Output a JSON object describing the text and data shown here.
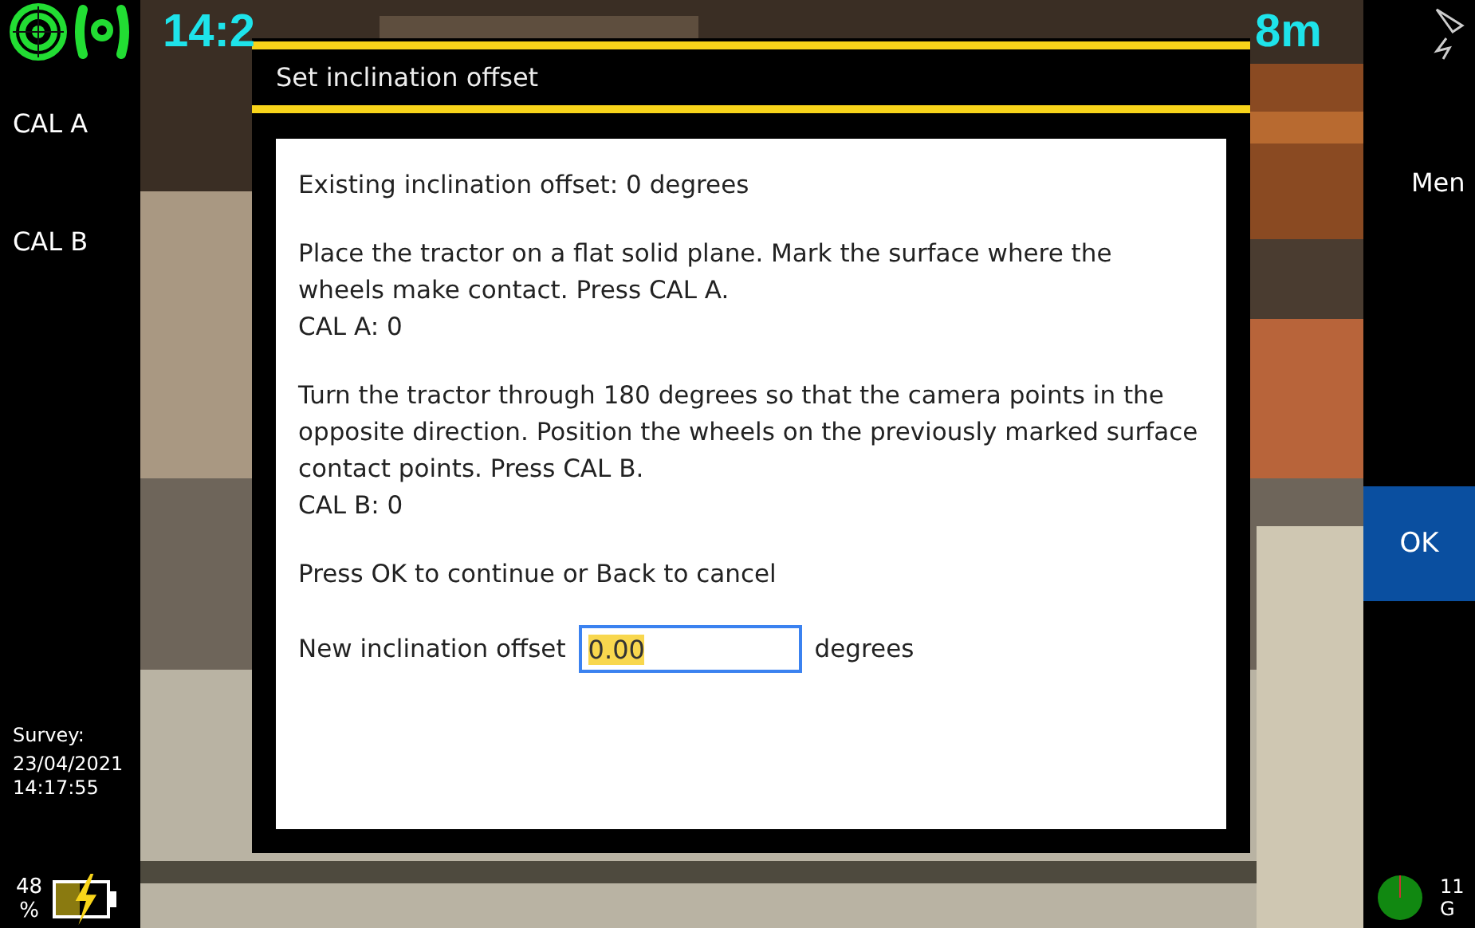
{
  "header": {
    "time": "14:2",
    "distance": "8m"
  },
  "left_sidebar": {
    "buttons": [
      "CAL A",
      "CAL B"
    ],
    "survey_label": "Survey:",
    "survey_date": "23/04/2021",
    "survey_time": "14:17:55",
    "battery_percent": "48",
    "battery_unit": "%",
    "battery": {
      "level": 0.48,
      "charging": true
    }
  },
  "right_sidebar": {
    "menu": "Men",
    "ok": "OK",
    "status_line1": "11",
    "status_line2": "G"
  },
  "dialog": {
    "title": "Set inclination offset",
    "paragraphs": [
      {
        "lines": [
          "Existing inclination offset: 0 degrees"
        ]
      },
      {
        "lines": [
          "Place the tractor on a flat solid plane. Mark the surface where the wheels make contact. Press CAL A.",
          "CAL A: 0"
        ]
      },
      {
        "lines": [
          "Turn the tractor through 180 degrees so that the camera points in the opposite direction. Position the wheels on the previously marked surface contact points. Press CAL B.",
          "CAL B: 0"
        ]
      },
      {
        "lines": [
          "Press OK to continue or Back to cancel"
        ]
      }
    ],
    "field_label": "New inclination offset",
    "field_value": "0.00",
    "field_unit": "degrees"
  }
}
